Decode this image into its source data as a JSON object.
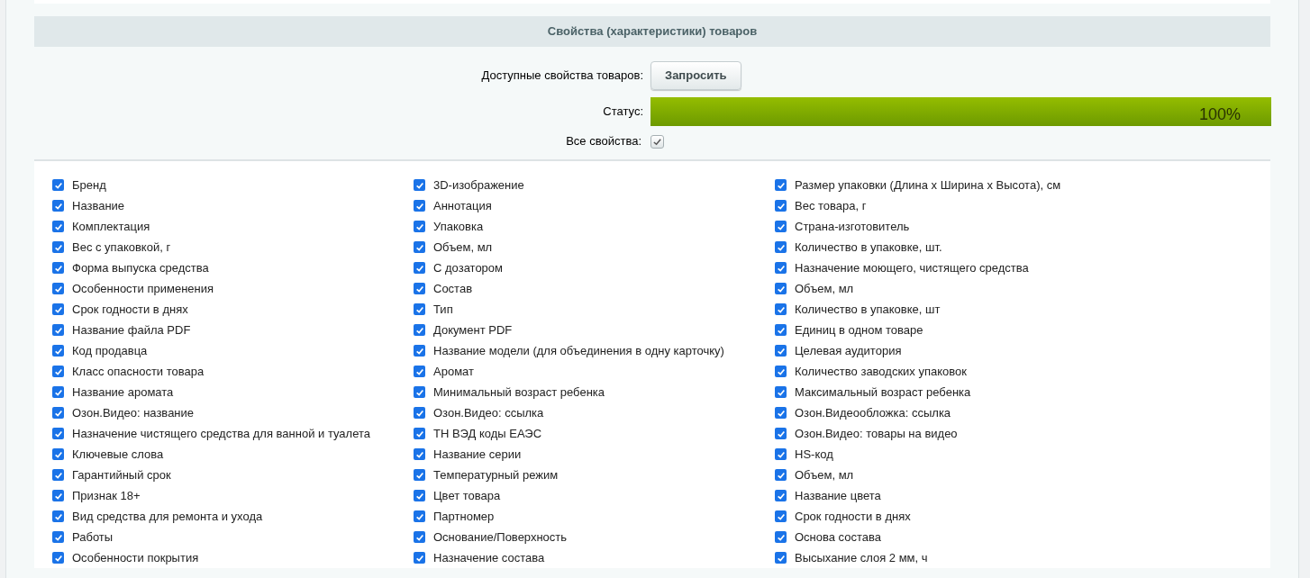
{
  "section": {
    "title": "Свойства (характеристики) товаров"
  },
  "form": {
    "available_label": "Доступные свойства товаров:",
    "request_button": "Запросить",
    "status_label": "Статус:",
    "status": {
      "level": 1,
      "reading": "100%"
    },
    "all_label": "Все свойства:",
    "all_checked": true
  },
  "columns": [
    [
      {
        "label": "Бренд",
        "checked": true
      },
      {
        "label": "Название",
        "checked": true
      },
      {
        "label": "Комплектация",
        "checked": true
      },
      {
        "label": "Вес с упаковкой, г",
        "checked": true
      },
      {
        "label": "Форма выпуска средства",
        "checked": true
      },
      {
        "label": "Особенности применения",
        "checked": true
      },
      {
        "label": "Срок годности в днях",
        "checked": true
      },
      {
        "label": "Название файла PDF",
        "checked": true
      },
      {
        "label": "Код продавца",
        "checked": true
      },
      {
        "label": "Класс опасности товара",
        "checked": true
      },
      {
        "label": "Название аромата",
        "checked": true
      },
      {
        "label": "Озон.Видео: название",
        "checked": true
      },
      {
        "label": "Назначение чистящего средства для ванной и туалета",
        "checked": true
      },
      {
        "label": "Ключевые слова",
        "checked": true
      },
      {
        "label": "Гарантийный срок",
        "checked": true
      },
      {
        "label": "Признак 18+",
        "checked": true
      },
      {
        "label": "Вид средства для ремонта и ухода",
        "checked": true
      },
      {
        "label": "Работы",
        "checked": true
      },
      {
        "label": "Особенности покрытия",
        "checked": true
      }
    ],
    [
      {
        "label": "3D-изображение",
        "checked": true
      },
      {
        "label": "Аннотация",
        "checked": true
      },
      {
        "label": "Упаковка",
        "checked": true
      },
      {
        "label": "Объем, мл",
        "checked": true
      },
      {
        "label": "С дозатором",
        "checked": true
      },
      {
        "label": "Состав",
        "checked": true
      },
      {
        "label": "Тип",
        "checked": true
      },
      {
        "label": "Документ PDF",
        "checked": true
      },
      {
        "label": "Название модели (для объединения в одну карточку)",
        "checked": true
      },
      {
        "label": "Аромат",
        "checked": true
      },
      {
        "label": "Минимальный возраст ребенка",
        "checked": true
      },
      {
        "label": "Озон.Видео: ссылка",
        "checked": true
      },
      {
        "label": "ТН ВЭД коды ЕАЭС",
        "checked": true
      },
      {
        "label": "Название серии",
        "checked": true
      },
      {
        "label": "Температурный режим",
        "checked": true
      },
      {
        "label": "Цвет товара",
        "checked": true
      },
      {
        "label": "Партномер",
        "checked": true
      },
      {
        "label": "Основание/Поверхность",
        "checked": true
      },
      {
        "label": "Назначение состава",
        "checked": true
      }
    ],
    [
      {
        "label": "Размер упаковки (Длина х Ширина х Высота), см",
        "checked": true
      },
      {
        "label": "Вес товара, г",
        "checked": true
      },
      {
        "label": "Страна-изготовитель",
        "checked": true
      },
      {
        "label": "Количество в упаковке, шт.",
        "checked": true
      },
      {
        "label": "Назначение моющего, чистящего средства",
        "checked": true
      },
      {
        "label": "Объем, мл",
        "checked": true
      },
      {
        "label": "Количество в упаковке, шт",
        "checked": true
      },
      {
        "label": "Единиц в одном товаре",
        "checked": true
      },
      {
        "label": "Целевая аудитория",
        "checked": true
      },
      {
        "label": "Количество заводских упаковок",
        "checked": true
      },
      {
        "label": "Максимальный возраст ребенка",
        "checked": true
      },
      {
        "label": "Озон.Видеообложка: ссылка",
        "checked": true
      },
      {
        "label": "Озон.Видео: товары на видео",
        "checked": true
      },
      {
        "label": "HS-код",
        "checked": true
      },
      {
        "label": "Объем, мл",
        "checked": true
      },
      {
        "label": "Название цвета",
        "checked": true
      },
      {
        "label": "Срок годности в днях",
        "checked": true
      },
      {
        "label": "Основа состава",
        "checked": true
      },
      {
        "label": "Высыхание слоя 2 мм, ч",
        "checked": true
      }
    ]
  ]
}
